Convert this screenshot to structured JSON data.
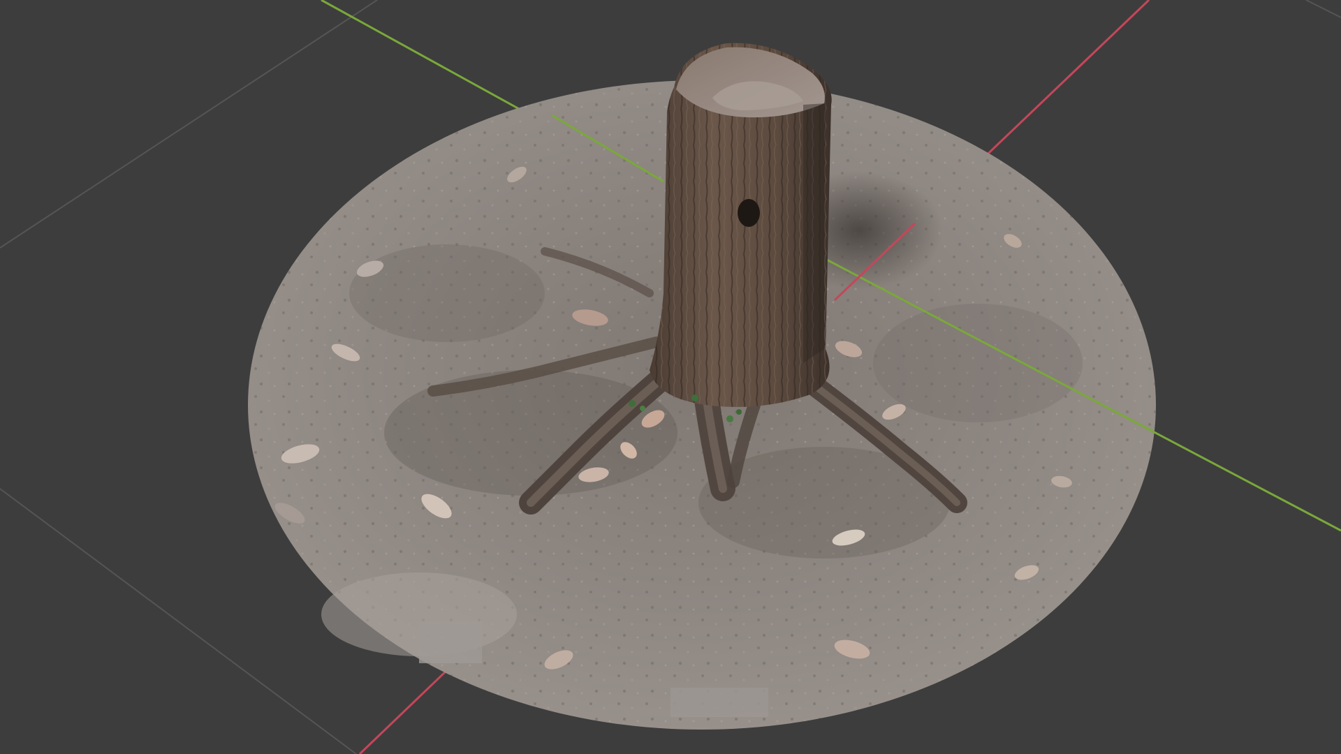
{
  "viewport": {
    "mode": "3d-viewport",
    "background_color": "#3d3d3d",
    "grid_line_color": "#555555",
    "x_axis_color": "#c4475a",
    "y_axis_color": "#7aa83a"
  },
  "scene": {
    "object": "tree-stump-on-ground-scan",
    "ground_color": "#8b8480",
    "stump_color": "#5a4a40"
  }
}
